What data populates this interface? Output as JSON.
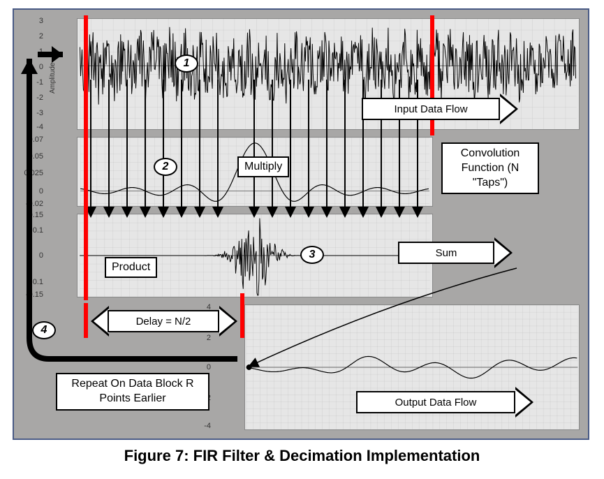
{
  "caption": "Figure 7: FIR Filter & Decimation Implementation",
  "steps": {
    "1": "1",
    "2": "2",
    "3": "3",
    "4": "4"
  },
  "labels": {
    "input_flow": "Input Data Flow",
    "multiply": "Multiply",
    "convolution": "Convolution Function (N \"Taps\")",
    "product": "Product",
    "sum": "Sum",
    "delay": "Delay = N/2",
    "repeat": "Repeat On Data Block R Points Earlier",
    "output_flow": "Output Data Flow",
    "ylabel": "Amplitude"
  },
  "yaxes": {
    "p1": [
      "3",
      "2",
      "1",
      "0",
      "-1",
      "-2",
      "-3",
      "-4"
    ],
    "p2": [
      "0.07",
      "0.05",
      "0.025",
      "0",
      "-0.02"
    ],
    "p3": [
      "0.15",
      "0.1",
      "0",
      "-0.1",
      "-0.15"
    ],
    "p4": [
      "4",
      "2",
      "0",
      "-2",
      "-4"
    ]
  },
  "chart_data": [
    {
      "type": "line",
      "name": "input_signal",
      "description": "Noisy input amplitude signal",
      "ylim": [
        -4,
        3
      ],
      "xlabel": "",
      "ylabel": "Amplitude",
      "series": [
        {
          "name": "input",
          "nature": "random_noise",
          "approx_range": [
            -3,
            3
          ],
          "n_points": 500
        }
      ]
    },
    {
      "type": "line",
      "name": "convolution_kernel",
      "description": "FIR filter convolution function (sinc-like kernel, N taps)",
      "ylim": [
        -0.02,
        0.07
      ],
      "xlabel": "",
      "ylabel": "",
      "series": [
        {
          "name": "kernel",
          "nature": "sinc_pulse",
          "peak": 0.07,
          "center": 0.5
        }
      ]
    },
    {
      "type": "line",
      "name": "product",
      "description": "Pointwise product of input and kernel",
      "ylim": [
        -0.15,
        0.15
      ],
      "xlabel": "",
      "ylabel": "",
      "series": [
        {
          "name": "product",
          "nature": "burst",
          "center": 0.5,
          "peak": 0.15
        }
      ]
    },
    {
      "type": "line",
      "name": "output_signal",
      "description": "Decimated output data",
      "ylim": [
        -4,
        4
      ],
      "xlabel": "",
      "ylabel": "",
      "series": [
        {
          "name": "output",
          "nature": "low_freq_wave",
          "approx_range": [
            -1,
            1
          ]
        }
      ]
    }
  ]
}
